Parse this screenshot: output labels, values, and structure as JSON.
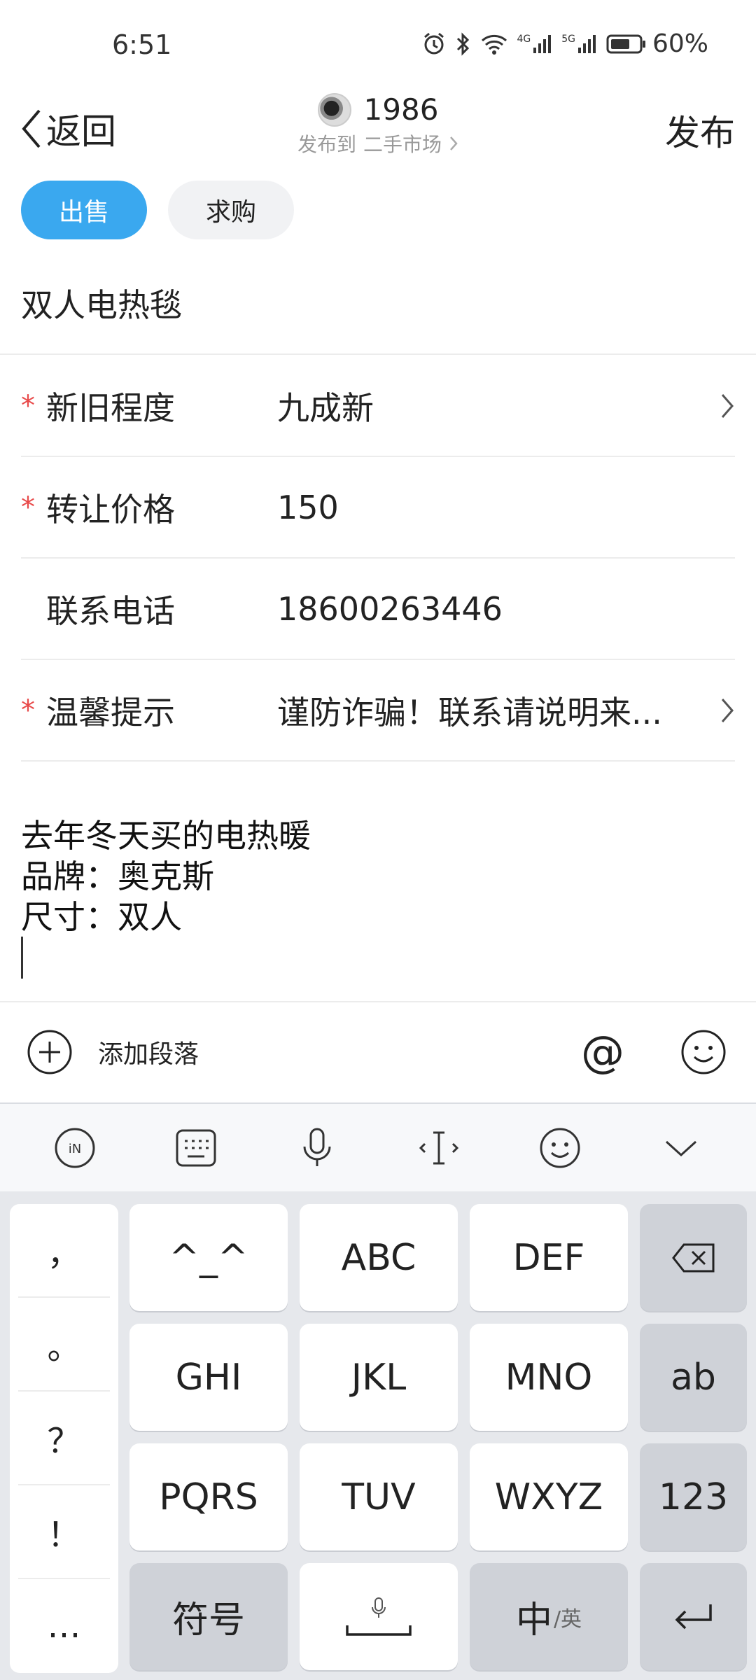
{
  "status_bar": {
    "time": "6:51",
    "battery": "60%",
    "net1": "4G",
    "net2": "5G"
  },
  "header": {
    "back_label": "返回",
    "username": "1986",
    "publish_to": "发布到",
    "market": "二手市场",
    "publish_label": "发布"
  },
  "type_tabs": [
    {
      "label": "出售",
      "active": true
    },
    {
      "label": "求购",
      "active": false
    }
  ],
  "title": "双人电热毯",
  "form": [
    {
      "required": true,
      "label": "新旧程度",
      "value": "九成新",
      "chevron": true
    },
    {
      "required": true,
      "label": "转让价格",
      "value": "150",
      "chevron": false
    },
    {
      "required": false,
      "label": "联系电话",
      "value": "18600263446",
      "chevron": false
    },
    {
      "required": true,
      "label": "温馨提示",
      "value": "谨防诈骗！联系请说明来...",
      "chevron": true
    }
  ],
  "description": {
    "line1": "去年冬天买的电热暖",
    "line2": "品牌：奥克斯",
    "line3": "尺寸：双人"
  },
  "toolbar": {
    "add_paragraph": "添加段落",
    "at_symbol": "@"
  },
  "keyboard": {
    "punctuation": [
      "，",
      "。",
      "？",
      "！",
      "…"
    ],
    "rows": [
      [
        "^_^",
        "ABC",
        "DEF"
      ],
      [
        "GHI",
        "JKL",
        "MNO"
      ],
      [
        "PQRS",
        "TUV",
        "WXYZ"
      ]
    ],
    "side_keys": {
      "ab": "ab",
      "num": "123"
    },
    "symbol_key": "符号",
    "lang_key_main": "中",
    "lang_key_sub": "/英"
  },
  "colors": {
    "accent": "#3aa8ef",
    "required": "#e84a4a"
  }
}
